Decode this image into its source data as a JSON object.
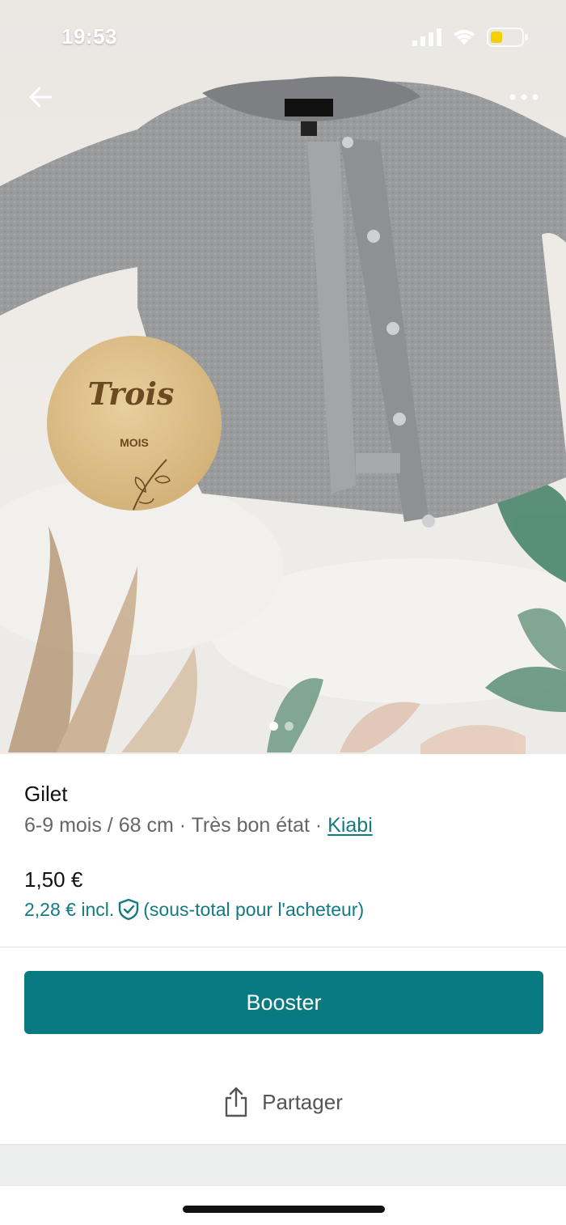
{
  "status_bar": {
    "time": "19:53"
  },
  "gallery": {
    "badge_title": "Trois",
    "badge_subtitle": "MOIS",
    "image_count": 2,
    "active_index": 0
  },
  "item": {
    "title": "Gilet",
    "size": "6-9 mois / 68 cm",
    "condition": "Très bon état",
    "separator": "·",
    "brand": "Kiabi",
    "price": "1,50 €",
    "buyer_price_amount": "2,28 € incl.",
    "buyer_price_note": "(sous-total pour l'acheteur)"
  },
  "actions": {
    "booster_label": "Booster",
    "share_label": "Partager"
  },
  "icons": {
    "back": "arrow-left-icon",
    "more": "more-dots-icon",
    "shield": "shield-check-icon",
    "share": "share-icon"
  },
  "colors": {
    "accent": "#087a80",
    "link": "#137a82"
  }
}
